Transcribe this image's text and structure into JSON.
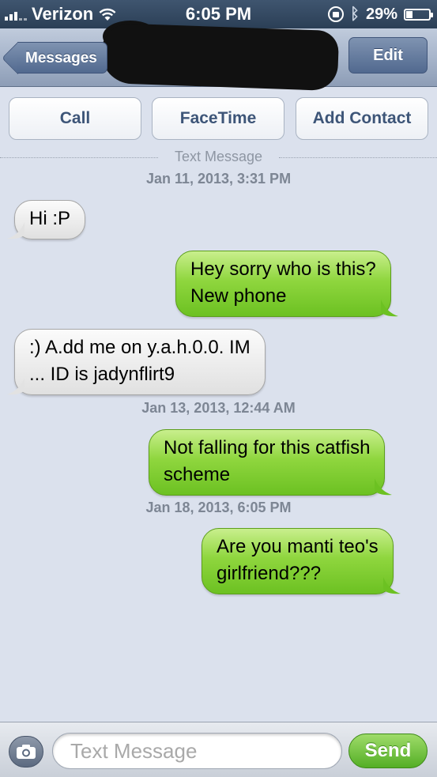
{
  "status_bar": {
    "carrier": "Verizon",
    "time": "6:05 PM",
    "battery": "29%",
    "battery_level": 0.29,
    "icons": [
      "signal-bars-icon",
      "wifi-icon",
      "rotation-lock-icon",
      "bluetooth-icon",
      "battery-icon"
    ]
  },
  "nav": {
    "back_label": "Messages",
    "edit_label": "Edit"
  },
  "actions": {
    "call": "Call",
    "facetime": "FaceTime",
    "add_contact": "Add Contact"
  },
  "conversation": {
    "divider_label": "Text Message",
    "items": [
      {
        "type": "timestamp",
        "text": "Jan 11, 2013, 3:31 PM"
      },
      {
        "type": "message",
        "direction": "incoming",
        "lines": [
          "Hi :P"
        ]
      },
      {
        "type": "message",
        "direction": "outgoing",
        "lines": [
          "Hey sorry who is this?",
          "New phone"
        ]
      },
      {
        "type": "message",
        "direction": "incoming",
        "lines": [
          ":) A.dd me on y.a.h.0.0. IM",
          "... ID is jadynflirt9"
        ]
      },
      {
        "type": "timestamp",
        "text": "Jan 13, 2013, 12:44 AM"
      },
      {
        "type": "message",
        "direction": "outgoing",
        "lines": [
          "Not falling for this catfish",
          "scheme"
        ]
      },
      {
        "type": "timestamp",
        "text": "Jan 18, 2013, 6:05 PM"
      },
      {
        "type": "message",
        "direction": "outgoing",
        "lines": [
          "Are you manti teo's",
          "girlfriend???"
        ]
      }
    ]
  },
  "input_bar": {
    "placeholder": "Text Message",
    "value": "",
    "send_label": "Send"
  },
  "colors": {
    "outgoing_bubble": "#7fcf33",
    "incoming_bubble": "#ececec",
    "background": "#dbe1ed",
    "nav_bar": "#a7b5cb"
  }
}
